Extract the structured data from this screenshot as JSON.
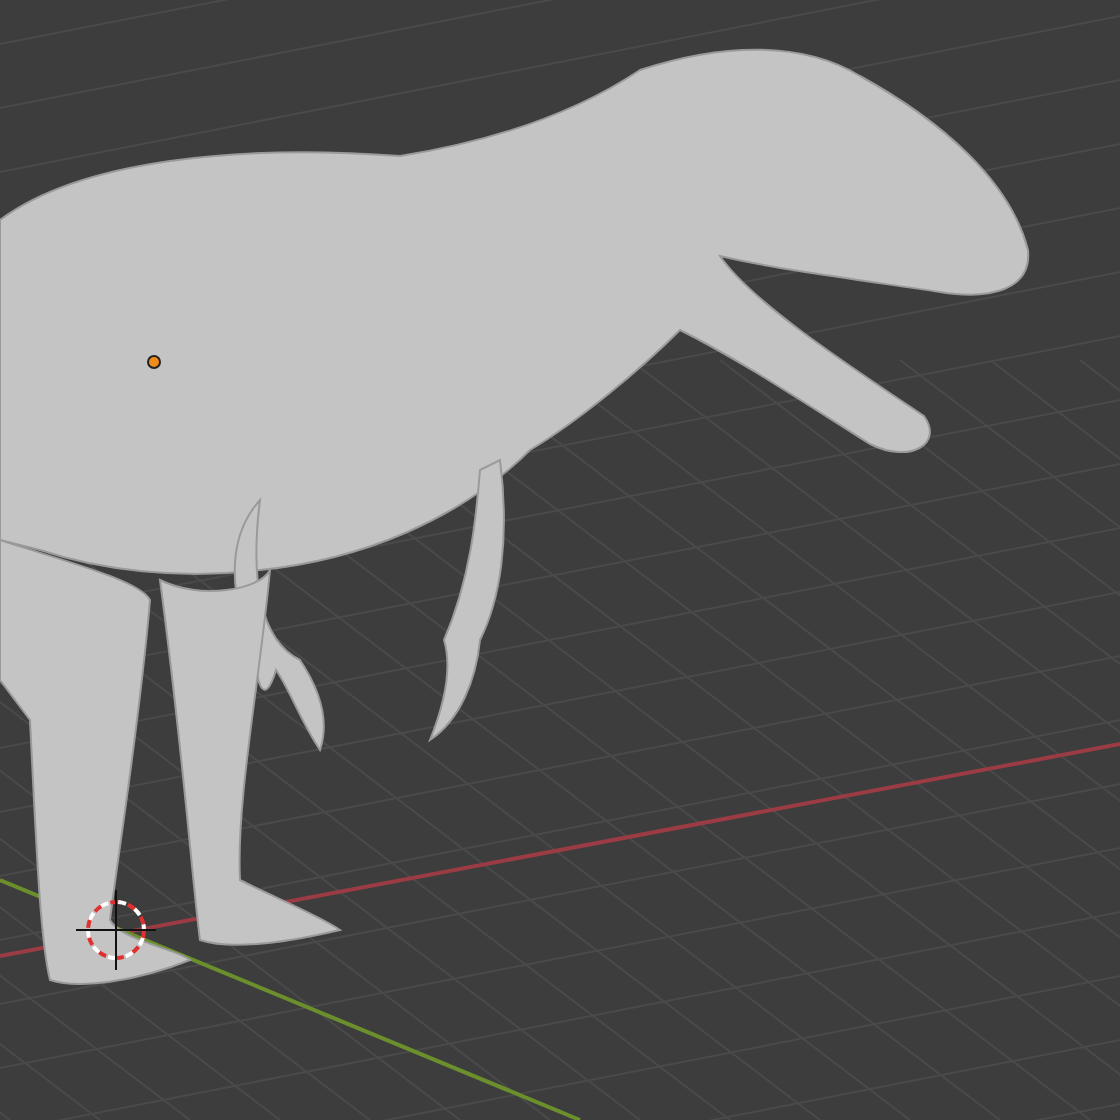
{
  "viewport": {
    "axes": [
      {
        "kind": "x",
        "color": "#9b3b44"
      },
      {
        "kind": "y",
        "color": "#6b8f2c"
      }
    ],
    "origin_selected": true,
    "cursor_shown": true
  }
}
